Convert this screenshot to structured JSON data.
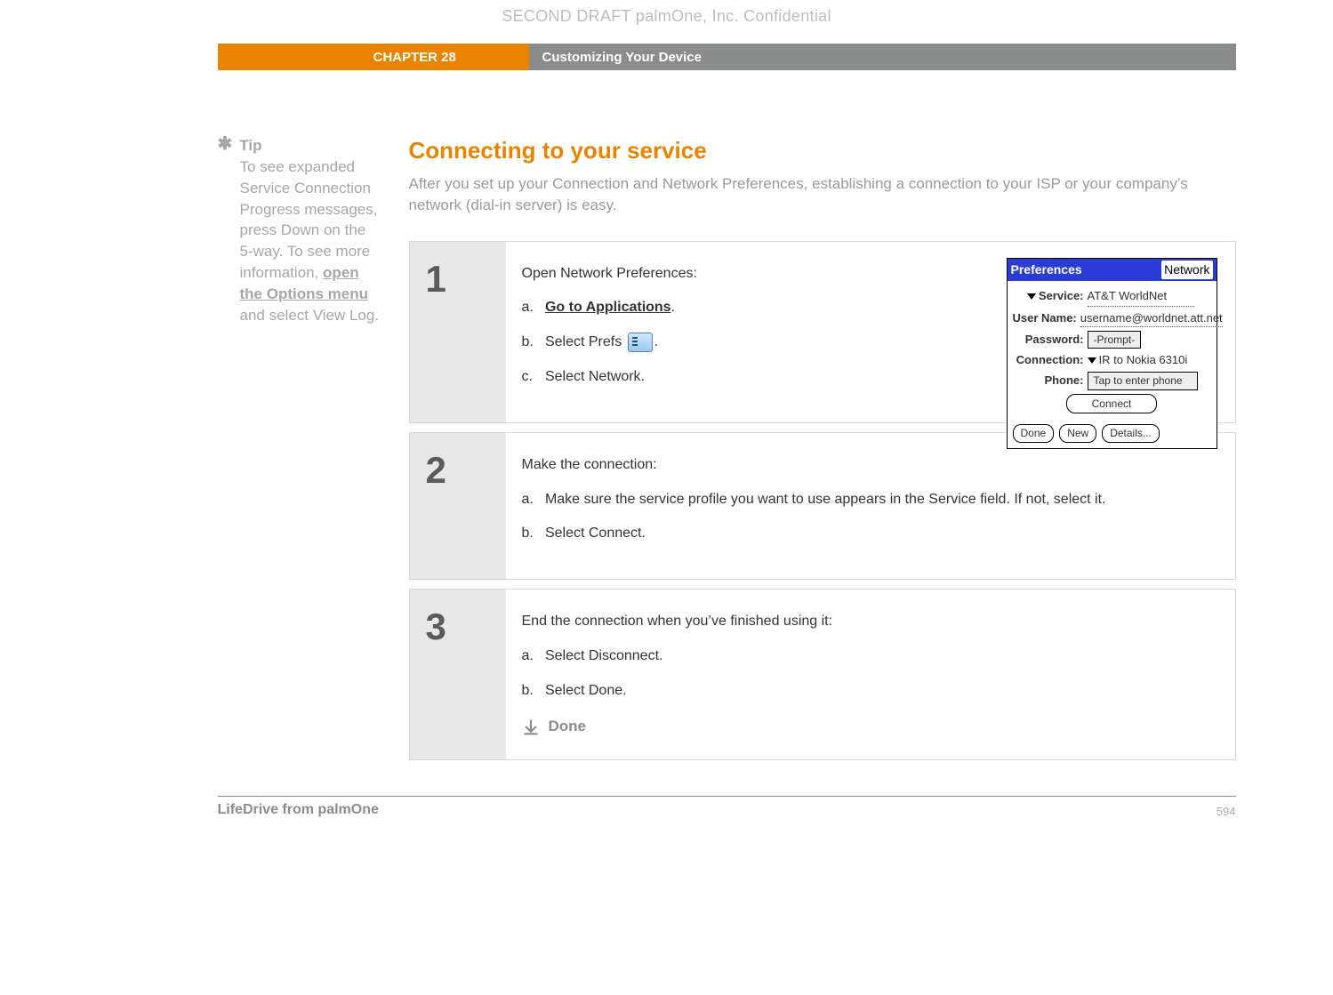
{
  "watermark": "SECOND DRAFT palmOne, Inc.  Confidential",
  "header": {
    "chapter": "CHAPTER 28",
    "title": "Customizing Your Device"
  },
  "tip": {
    "label": "Tip",
    "body_pre": "To see expanded Service Connection Progress messages, press Down on the 5-way. To see more information, ",
    "link": "open the Options menu ",
    "body_post": "and select View Log."
  },
  "section": {
    "heading": "Connecting to your service",
    "intro": "After you set up your Connection and Network Preferences, establishing a connection to your ISP or your company’s network (dial-in server) is easy."
  },
  "steps": [
    {
      "num": "1",
      "lead": "Open Network Preferences:",
      "items": [
        {
          "letter": "a.",
          "pre": "",
          "link": "Go to Applications",
          "post": "."
        },
        {
          "letter": "b.",
          "pre": "Select Prefs ",
          "icon": "prefs",
          "post": "."
        },
        {
          "letter": "c.",
          "pre": "Select Network.",
          "post": ""
        }
      ],
      "palm": {
        "title_left": "Preferences",
        "title_right": "Network",
        "rows": {
          "service_label": "Service:",
          "service_value": "AT&T WorldNet",
          "username_label": "User Name:",
          "username_value": "username@worldnet.att.net",
          "password_label": "Password:",
          "password_value": "-Prompt-",
          "connection_label": "Connection:",
          "connection_value": "IR to Nokia 6310i",
          "phone_label": "Phone:",
          "phone_value": "Tap to enter phone"
        },
        "connect_btn": "Connect",
        "foot": {
          "done": "Done",
          "new": "New",
          "details": "Details..."
        }
      }
    },
    {
      "num": "2",
      "lead": "Make the connection:",
      "items": [
        {
          "letter": "a.",
          "pre": "Make sure the service profile you want to use appears in the Service field. If not, select it.",
          "post": ""
        },
        {
          "letter": "b.",
          "pre": "Select Connect.",
          "post": ""
        }
      ]
    },
    {
      "num": "3",
      "lead": "End the connection when you’ve finished using it:",
      "items": [
        {
          "letter": "a.",
          "pre": "Select Disconnect.",
          "post": ""
        },
        {
          "letter": "b.",
          "pre": "Select Done.",
          "post": ""
        }
      ],
      "done": "Done"
    }
  ],
  "footer": {
    "product": "LifeDrive from palmOne",
    "page": "594"
  }
}
